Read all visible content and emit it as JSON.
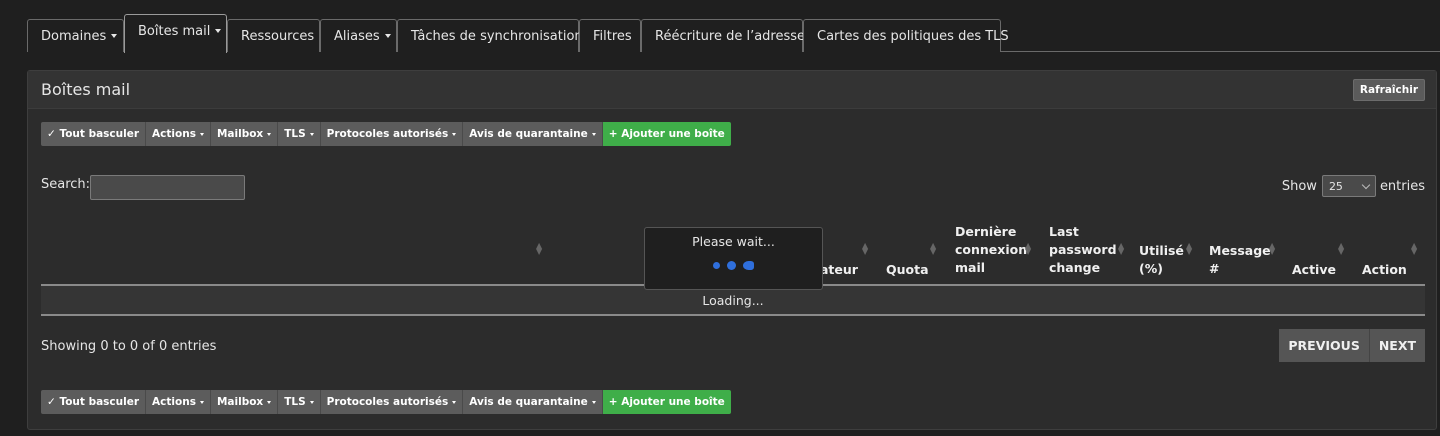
{
  "tabs": [
    {
      "label": "Domaines",
      "dropdown": true
    },
    {
      "label": "Boîtes mail",
      "dropdown": true,
      "active": true
    },
    {
      "label": "Ressources",
      "dropdown": false
    },
    {
      "label": "Aliases",
      "dropdown": true
    },
    {
      "label": "Tâches de synchronisation",
      "dropdown": false
    },
    {
      "label": "Filtres",
      "dropdown": false
    },
    {
      "label": "Réécriture de l’adresse",
      "dropdown": false
    },
    {
      "label": "Cartes des politiques des TLS",
      "dropdown": false
    }
  ],
  "panel": {
    "title": "Boîtes mail",
    "refresh_label": "Rafraîchir"
  },
  "toolbar": {
    "toggle_all": "✓ Tout basculer",
    "actions": "Actions",
    "mailbox": "Mailbox",
    "tls": "TLS",
    "protocols": "Protocoles autorisés",
    "quarantine": "Avis de quarantaine",
    "add_mailbox": "+ Ajouter une boîte"
  },
  "search": {
    "label": "Search:",
    "value": ""
  },
  "length": {
    "show_label": "Show",
    "value": "25",
    "entries_label": "entries"
  },
  "columns": {
    "user_partial": "ateur",
    "quota": "Quota",
    "last_login_1": "Dernière",
    "last_login_2": "connexion",
    "last_login_3": "mail",
    "last_pw_1": "Last",
    "last_pw_2": "password",
    "last_pw_3": "change",
    "used_1": "Utilisé",
    "used_2": "(%)",
    "msg_1": "Message",
    "msg_2": "#",
    "active": "Active",
    "action": "Action"
  },
  "table": {
    "loading_text": "Loading..."
  },
  "processing": {
    "text": "Please wait..."
  },
  "info": {
    "text": "Showing 0 to 0 of 0 entries"
  },
  "pagination": {
    "previous": "PREVIOUS",
    "next": "NEXT"
  },
  "colors": {
    "accent_green": "#3fae49",
    "spinner_blue": "#2f6fdc"
  }
}
